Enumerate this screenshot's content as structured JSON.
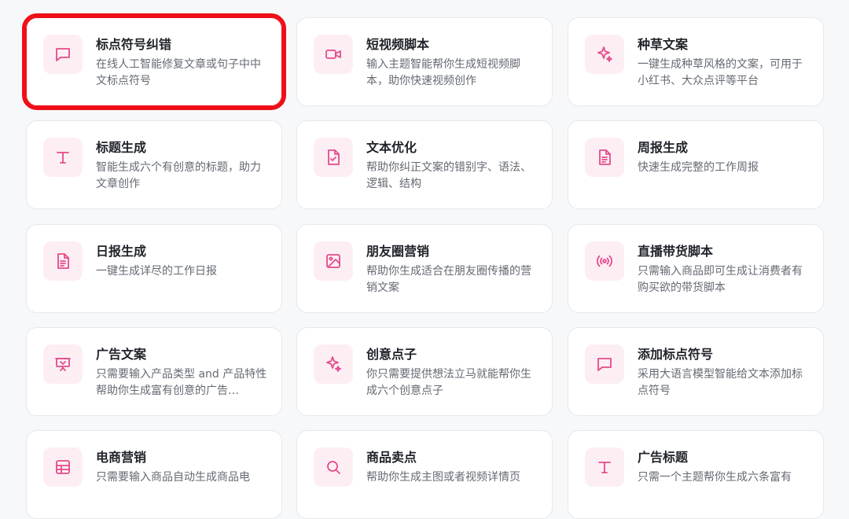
{
  "accent_color": "#e44b8c",
  "highlight_color": "#ee0f19",
  "cards": [
    {
      "title": "标点符号纠错",
      "desc": "在线人工智能修复文章或句子中中文标点符号",
      "icon": "message-square-icon"
    },
    {
      "title": "短视频脚本",
      "desc": "输入主题智能帮你生成短视频脚本，助你快速视频创作",
      "icon": "video-camera-icon"
    },
    {
      "title": "种草文案",
      "desc": "一键生成种草风格的文案，可用于小红书、大众点评等平台",
      "icon": "sparkles-icon"
    },
    {
      "title": "标题生成",
      "desc": "智能生成六个有创意的标题，助力文章创作",
      "icon": "text-t-icon"
    },
    {
      "title": "文本优化",
      "desc": "帮助你纠正文案的错别字、语法、逻辑、结构",
      "icon": "file-check-icon"
    },
    {
      "title": "周报生成",
      "desc": "快速生成完整的工作周报",
      "icon": "file-text-icon"
    },
    {
      "title": "日报生成",
      "desc": "一键生成详尽的工作日报",
      "icon": "file-text-icon"
    },
    {
      "title": "朋友圈营销",
      "desc": "帮助你生成适合在朋友圈传播的营销文案",
      "icon": "image-icon"
    },
    {
      "title": "直播带货脚本",
      "desc": "只需输入商品即可生成让消费者有购买欲的带货脚本",
      "icon": "broadcast-icon"
    },
    {
      "title": "广告文案",
      "desc": "只需要输入产品类型 and 产品特性帮助你生成富有创意的广告…",
      "icon": "presentation-icon"
    },
    {
      "title": "创意点子",
      "desc": "你只需要提供想法立马就能帮你生成六个创意点子",
      "icon": "sparkles-icon"
    },
    {
      "title": "添加标点符号",
      "desc": "采用大语言模型智能给文本添加标点符号",
      "icon": "message-square-icon"
    },
    {
      "title": "电商营销",
      "desc": "只需要输入商品自动生成商品电",
      "icon": "table-icon"
    },
    {
      "title": "商品卖点",
      "desc": "帮助你生成主图或者视频详情页",
      "icon": "search-icon"
    },
    {
      "title": "广告标题",
      "desc": "只需一个主题帮你生成六条富有",
      "icon": "text-t-icon"
    }
  ]
}
